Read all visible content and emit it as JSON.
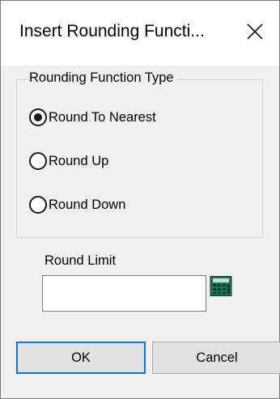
{
  "dialog": {
    "title": "Insert Rounding Functi...",
    "close_icon": "close-icon"
  },
  "group": {
    "legend": "Rounding Function Type",
    "options": [
      {
        "label": "Round To Nearest",
        "checked": true
      },
      {
        "label": "Round Up",
        "checked": false
      },
      {
        "label": "Round Down",
        "checked": false
      }
    ]
  },
  "round_limit": {
    "label": "Round Limit",
    "value": "",
    "calculator_icon": "calculator-icon"
  },
  "buttons": {
    "ok_label": "OK",
    "cancel_label": "Cancel"
  },
  "colors": {
    "accent": "#0078d7",
    "dialog_bg": "#f0f0f0",
    "calculator": "#1f6f55"
  }
}
